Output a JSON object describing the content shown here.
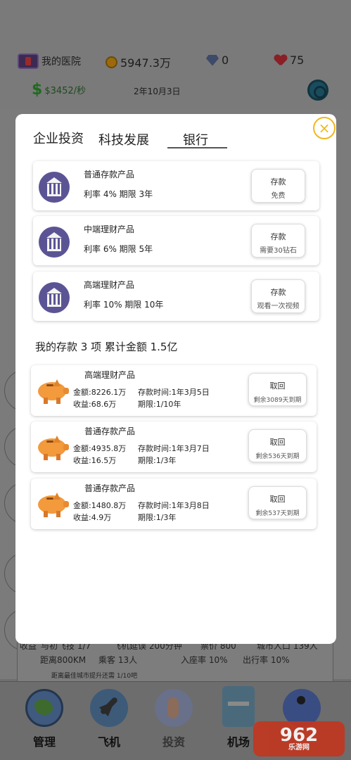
{
  "hud": {
    "hospital_label": "我的医院",
    "coins": "5947.3万",
    "gems": "0",
    "hearts": "75",
    "income_rate": "$3452/秒",
    "game_date": "2年10月3日"
  },
  "background_info": {
    "row1": [
      "收益",
      "与初飞技 1/7",
      "飞机延误 200分钟",
      "票价 800",
      "城市人口 139人"
    ],
    "distance": "距离800KM",
    "passengers": "乘客 13人",
    "seat_rate": "入座率 10%",
    "departure_rate": "出行率 10%",
    "footer": "距离最佳城市提升还需 1/10吧"
  },
  "tabs": {
    "items": [
      "企业投资",
      "科技发展",
      "银行"
    ],
    "active_index": 2
  },
  "products": [
    {
      "name": "普通存款产品",
      "rate": "利率 4% 期限 3年",
      "button": "存款",
      "button_sub": "免费"
    },
    {
      "name": "中端理财产品",
      "rate": "利率 6% 期限 5年",
      "button": "存款",
      "button_sub": "需要30钻石"
    },
    {
      "name": "高端理财产品",
      "rate": "利率 10% 期限 10年",
      "button": "存款",
      "button_sub": "观看一次视频"
    }
  ],
  "summary": "我的存款 3 项  累计金额 1.5亿",
  "deposits": [
    {
      "name": "高端理财产品",
      "amount": "金额:8226.1万",
      "income": "收益:68.6万",
      "time": "存款时间:1年3月5日",
      "term": "期限:1/10年",
      "button": "取回",
      "remaining": "剩余3089天到期"
    },
    {
      "name": "普通存款产品",
      "amount": "金额:4935.8万",
      "income": "收益:16.5万",
      "time": "存款时间:1年3月7日",
      "term": "期限:1/3年",
      "button": "取回",
      "remaining": "剩余536天到期"
    },
    {
      "name": "普通存款产品",
      "amount": "金额:1480.8万",
      "income": "收益:4.9万",
      "time": "存款时间:1年3月8日",
      "term": "期限:1/3年",
      "button": "取回",
      "remaining": "剩余537天到期"
    }
  ],
  "nav": {
    "items": [
      "管理",
      "飞机",
      "投资",
      "机场",
      ""
    ]
  },
  "watermark": {
    "text": "962",
    "sub": "乐游网"
  },
  "close_symbol": "×",
  "colors": {
    "accent_close": "#f0b81e",
    "bank_icon": "#5b5494",
    "pig": "#f29a3c"
  }
}
